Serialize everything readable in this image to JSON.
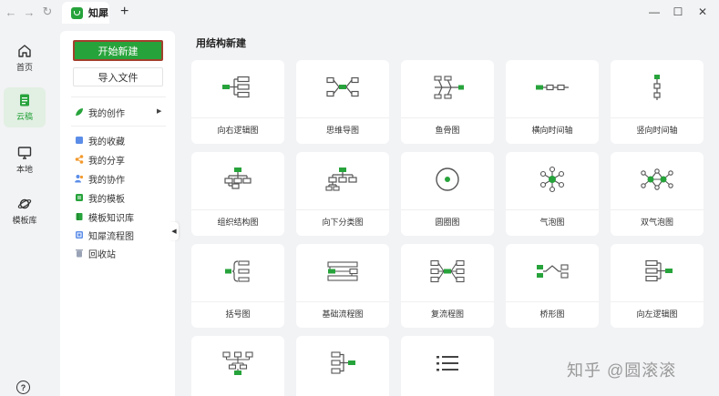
{
  "window": {
    "tab_title": "知犀",
    "nav": {
      "back": "←",
      "forward": "→",
      "reload": "↻"
    },
    "new_tab": "+",
    "controls": {
      "minimize": "—",
      "maximize": "☐",
      "close": "✕"
    }
  },
  "rail": {
    "items": [
      {
        "label": "首页",
        "icon": "home-icon"
      },
      {
        "label": "云稿",
        "icon": "cloud-doc-icon",
        "active": true
      },
      {
        "label": "本地",
        "icon": "monitor-icon"
      },
      {
        "label": "模板库",
        "icon": "planet-icon"
      }
    ],
    "help": "?"
  },
  "sidebar": {
    "new_button": "开始新建",
    "import_button": "导入文件",
    "my_creations": "我的创作",
    "my_creations_arrow": "▶",
    "items": [
      {
        "label": "我的收藏",
        "color": "#5b8de8"
      },
      {
        "label": "我的分享",
        "color": "#f39a2d"
      },
      {
        "label": "我的协作",
        "color": "#5b8de8"
      },
      {
        "label": "我的模板",
        "color": "#27a33b"
      },
      {
        "label": "模板知识库",
        "color": "#27a33b"
      },
      {
        "label": "知犀流程图",
        "color": "#5b8de8"
      },
      {
        "label": "回收站",
        "color": "#9aa3b5"
      }
    ],
    "collapse_arrow": "◀"
  },
  "main": {
    "section_title": "用结构新建",
    "cards": [
      {
        "label": "向右逻辑图",
        "icon": "right-logic-icon"
      },
      {
        "label": "思维导图",
        "icon": "mind-map-icon"
      },
      {
        "label": "鱼骨图",
        "icon": "fishbone-icon"
      },
      {
        "label": "横向时间轴",
        "icon": "horizontal-timeline-icon"
      },
      {
        "label": "竖向时间轴",
        "icon": "vertical-timeline-icon"
      },
      {
        "label": "组织结构图",
        "icon": "org-chart-icon"
      },
      {
        "label": "向下分类图",
        "icon": "down-tree-icon"
      },
      {
        "label": "圆圈图",
        "icon": "circle-map-icon"
      },
      {
        "label": "气泡图",
        "icon": "bubble-map-icon"
      },
      {
        "label": "双气泡图",
        "icon": "double-bubble-icon"
      },
      {
        "label": "括号图",
        "icon": "brace-map-icon"
      },
      {
        "label": "基础流程图",
        "icon": "flowchart-icon"
      },
      {
        "label": "复流程图",
        "icon": "multi-flow-icon"
      },
      {
        "label": "桥形图",
        "icon": "bridge-map-icon"
      },
      {
        "label": "向左逻辑图",
        "icon": "left-logic-icon"
      },
      {
        "label": "",
        "icon": "up-tree-icon"
      },
      {
        "label": "",
        "icon": "left-brace-icon"
      },
      {
        "label": "",
        "icon": "list-icon"
      }
    ]
  },
  "watermark": "知乎 @圆滚滚",
  "colors": {
    "accent": "#27a33b",
    "accent_bg": "#e2efe3",
    "border_red": "#a3402d"
  }
}
